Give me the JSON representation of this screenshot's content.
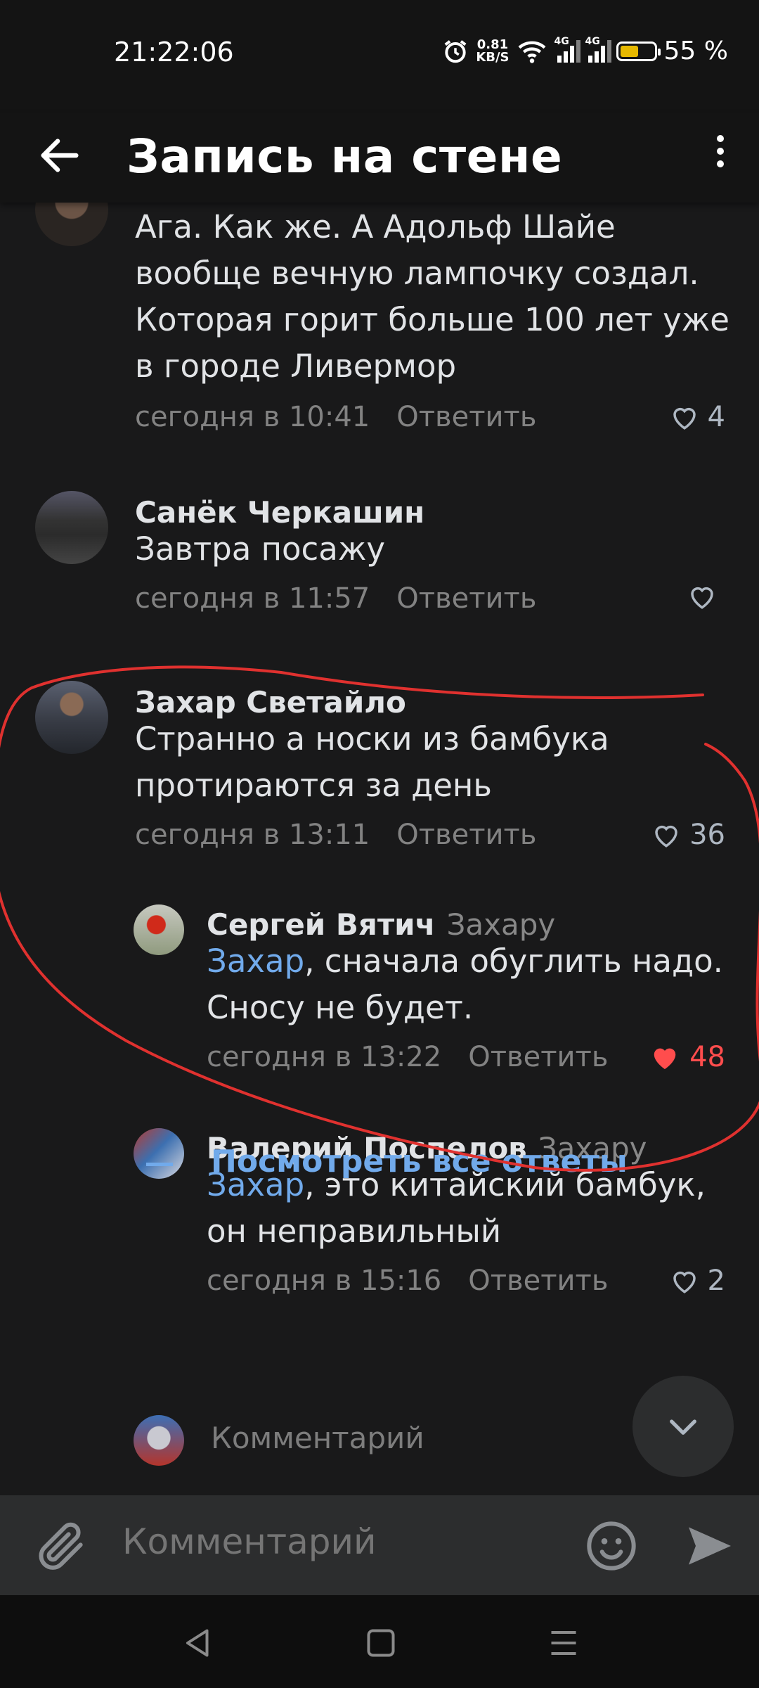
{
  "status_bar": {
    "time": "21:22:06",
    "speed_value": "0.81",
    "speed_unit": "KB/S",
    "network_1": "4G",
    "network_2": "4G",
    "battery_text": "55 %",
    "battery_level": 0.55,
    "icons": [
      "alarm-icon",
      "wifi-icon",
      "signal-icon",
      "battery-icon"
    ]
  },
  "app_bar": {
    "title": "Запись на стене",
    "back_icon": "arrow-left-icon",
    "menu_icon": "more-vertical-icon"
  },
  "comments": [
    {
      "author": "",
      "text": "Ага. Как же. А Адольф Шайе вообще вечную лампочку создал. Которая горит больше 100 лет уже в городе Ливермор",
      "time": "сегодня в 10:41",
      "reply_label": "Ответить",
      "likes": "4",
      "liked": false
    },
    {
      "author": "Санёк Черкашин",
      "text": "Завтра посажу",
      "time": "сегодня в 11:57",
      "reply_label": "Ответить",
      "likes": "",
      "liked": false
    },
    {
      "author": "Захар Светайло",
      "text": "Странно а носки из бамбука протираются за день",
      "time": "сегодня в 13:11",
      "reply_label": "Ответить",
      "likes": "36",
      "liked": false
    }
  ],
  "replies": [
    {
      "author": "Сергей Вятич",
      "reply_to": "Захару",
      "mention": "Захар",
      "text": ", сначала обуглить надо. Сносу не будет.",
      "time": "сегодня в 13:22",
      "reply_label": "Ответить",
      "likes": "48",
      "liked": true
    },
    {
      "author": "Валерий Поспелов",
      "reply_to": "Захару",
      "mention": "Захар",
      "text": ", это китайский бамбук, он неправильный",
      "time": "сегодня в 15:16",
      "reply_label": "Ответить",
      "likes": "2",
      "liked": false
    }
  ],
  "view_all_replies": "Посмотреть все ответы",
  "inline_comment_placeholder": "Комментарий",
  "composer": {
    "placeholder": "Комментарий",
    "attach_icon": "paperclip-icon",
    "emoji_icon": "smile-icon",
    "send_icon": "send-icon"
  },
  "scroll_down_icon": "chevron-down-icon",
  "nav_bar": {
    "icons": [
      "back-triangle-icon",
      "home-square-icon",
      "menu-lines-icon"
    ]
  },
  "colors": {
    "accent": "#71aaeb",
    "like_red": "#ff4d4d",
    "annotation_red": "#e0312f"
  }
}
